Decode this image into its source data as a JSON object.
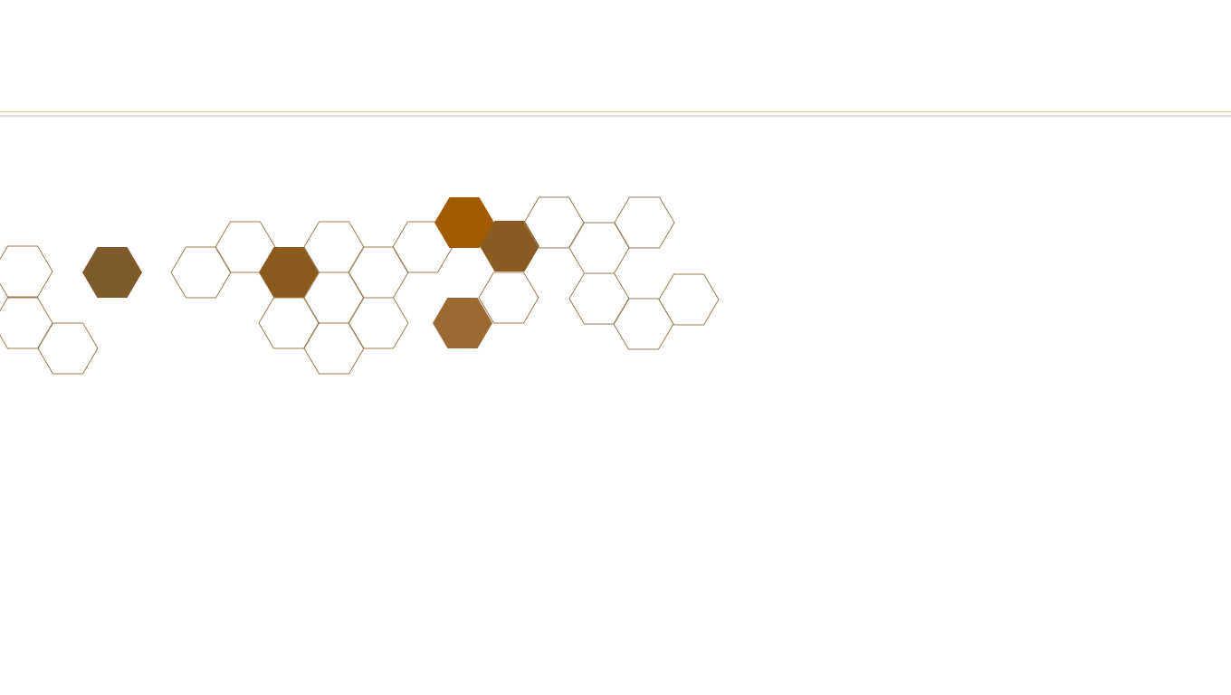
{
  "slide": {
    "background": "#ffffff",
    "rule_color": "#e3c48a"
  },
  "honeycomb": {
    "outline_color": "#9a7b54",
    "fill_colors": [
      "#7f5a2b",
      "#8a5a1e",
      "#a35b00",
      "#8a5c22",
      "#9a6a32"
    ]
  }
}
